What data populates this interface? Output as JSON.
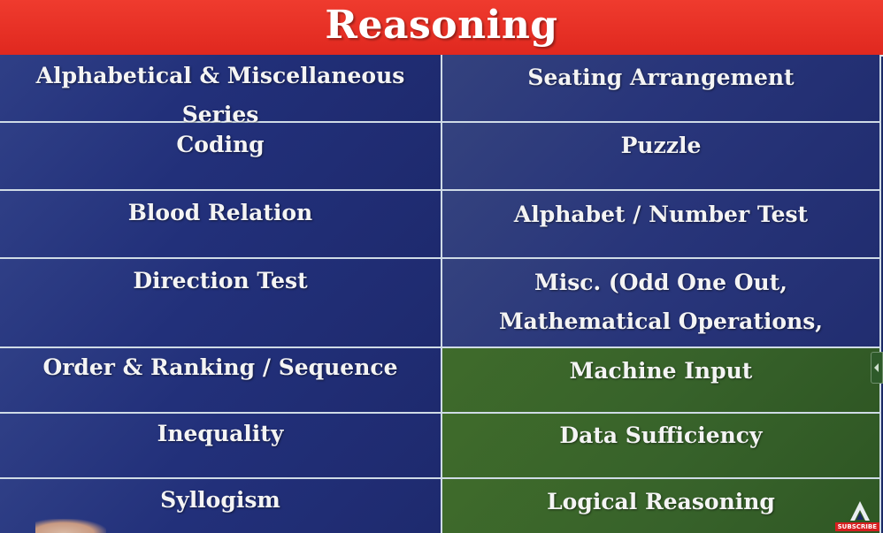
{
  "title": "Reasoning",
  "rows": [
    {
      "left": "Alphabetical & Miscellaneous Series",
      "right": "Seating Arrangement"
    },
    {
      "left": "Coding",
      "right": "Puzzle"
    },
    {
      "left": "Blood Relation",
      "right": "Alphabet / Number Test"
    },
    {
      "left": "Direction Test",
      "right": "Misc. (Odd One Out, Mathematical Operations, Analogy)"
    },
    {
      "left": "Order & Ranking / Sequence",
      "right": "Machine Input"
    },
    {
      "left": "Inequality",
      "right": "Data Sufficiency"
    },
    {
      "left": "Syllogism",
      "right": "Logical Reasoning"
    }
  ],
  "brand_badge": "SUBSCRIBE",
  "colors": {
    "title_bar": "#e82a20",
    "cell_blue": "#22307a",
    "cell_green": "#37622a",
    "grid_line": "#cfdbe6"
  }
}
